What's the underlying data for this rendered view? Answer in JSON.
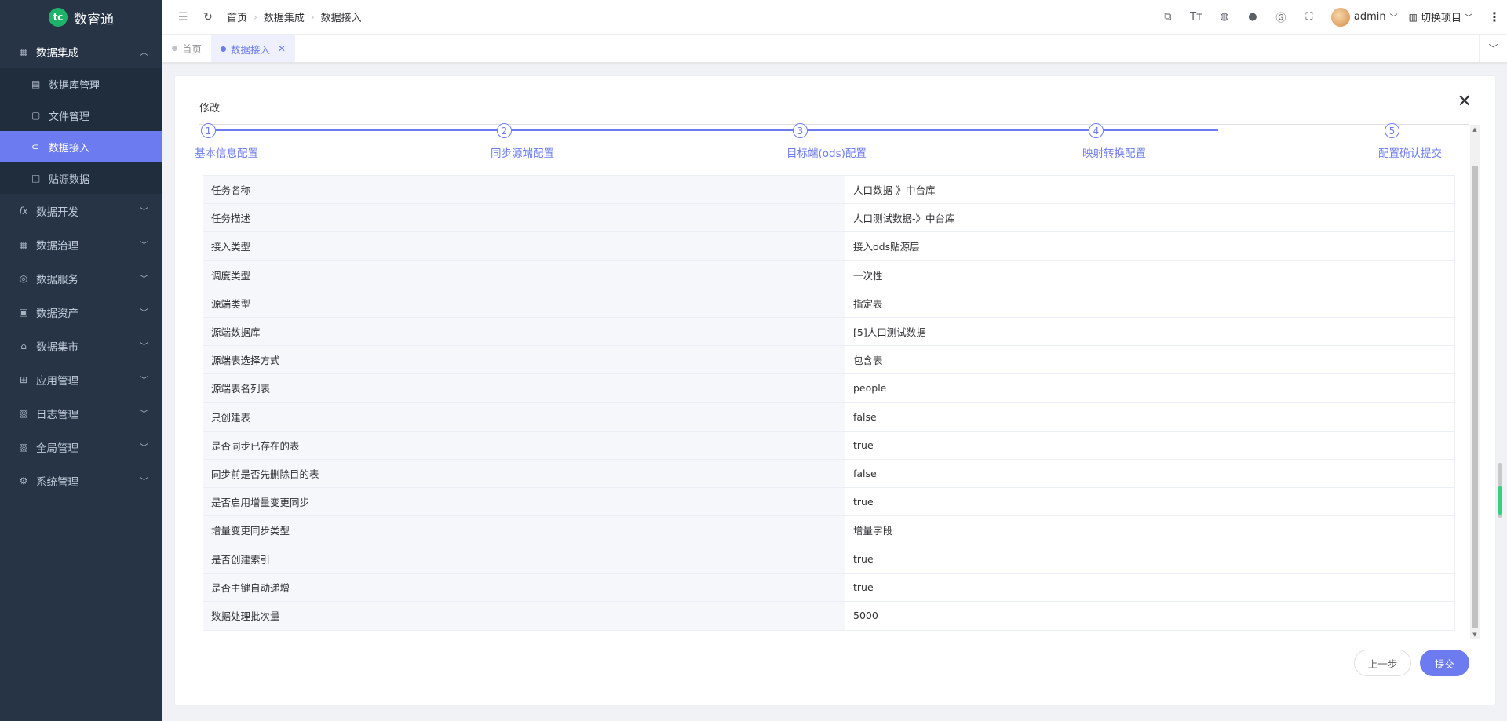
{
  "app": {
    "logo_mark": "tc",
    "logo_text": "数睿通"
  },
  "sidebar": {
    "groups": [
      {
        "label": "数据集成",
        "icon": "grid-icon",
        "open": true,
        "items": [
          {
            "label": "数据库管理",
            "icon": "table-icon"
          },
          {
            "label": "文件管理",
            "icon": "file-icon"
          },
          {
            "label": "数据接入",
            "icon": "link-icon",
            "active": true
          },
          {
            "label": "贴源数据",
            "icon": "square-icon"
          }
        ]
      },
      {
        "label": "数据开发",
        "icon": "fx-icon"
      },
      {
        "label": "数据治理",
        "icon": "grid-icon"
      },
      {
        "label": "数据服务",
        "icon": "service-icon"
      },
      {
        "label": "数据资产",
        "icon": "asset-icon"
      },
      {
        "label": "数据集市",
        "icon": "market-icon"
      },
      {
        "label": "应用管理",
        "icon": "apps-icon"
      },
      {
        "label": "日志管理",
        "icon": "log-icon"
      },
      {
        "label": "全局管理",
        "icon": "global-icon"
      },
      {
        "label": "系统管理",
        "icon": "gear-icon"
      }
    ]
  },
  "header": {
    "breadcrumb": [
      "首页",
      "数据集成",
      "数据接入"
    ],
    "user_name": "admin",
    "project_label": "切换项目"
  },
  "tabs": [
    {
      "label": "首页",
      "active": false
    },
    {
      "label": "数据接入",
      "active": true
    }
  ],
  "dialog": {
    "title": "修改",
    "steps": [
      {
        "num": "1",
        "label": "基本信息配置"
      },
      {
        "num": "2",
        "label": "同步源端配置"
      },
      {
        "num": "3",
        "label": "目标端(ods)配置"
      },
      {
        "num": "4",
        "label": "映射转换配置"
      },
      {
        "num": "5",
        "label": "配置确认提交"
      }
    ],
    "rows": [
      {
        "label": "任务名称",
        "value": "人口数据-》中台库"
      },
      {
        "label": "任务描述",
        "value": "人口测试数据-》中台库"
      },
      {
        "label": "接入类型",
        "value": "接入ods贴源层"
      },
      {
        "label": "调度类型",
        "value": "一次性"
      },
      {
        "label": "源端类型",
        "value": "指定表"
      },
      {
        "label": "源端数据库",
        "value": "[5]人口测试数据"
      },
      {
        "label": "源端表选择方式",
        "value": "包含表"
      },
      {
        "label": "源端表名列表",
        "value": "people"
      },
      {
        "label": "只创建表",
        "value": "false"
      },
      {
        "label": "是否同步已存在的表",
        "value": "true"
      },
      {
        "label": "同步前是否先删除目的表",
        "value": "false"
      },
      {
        "label": "是否启用增量变更同步",
        "value": "true"
      },
      {
        "label": "增量变更同步类型",
        "value": "增量字段"
      },
      {
        "label": "是否创建索引",
        "value": "true"
      },
      {
        "label": "是否主键自动递增",
        "value": "true"
      },
      {
        "label": "数据处理批次量",
        "value": "5000"
      }
    ],
    "prev_label": "上一步",
    "submit_label": "提交"
  },
  "colors": {
    "accent": "#6c7cf0",
    "sidebar_bg": "#263445",
    "submenu_bg": "#1f2d3d"
  }
}
